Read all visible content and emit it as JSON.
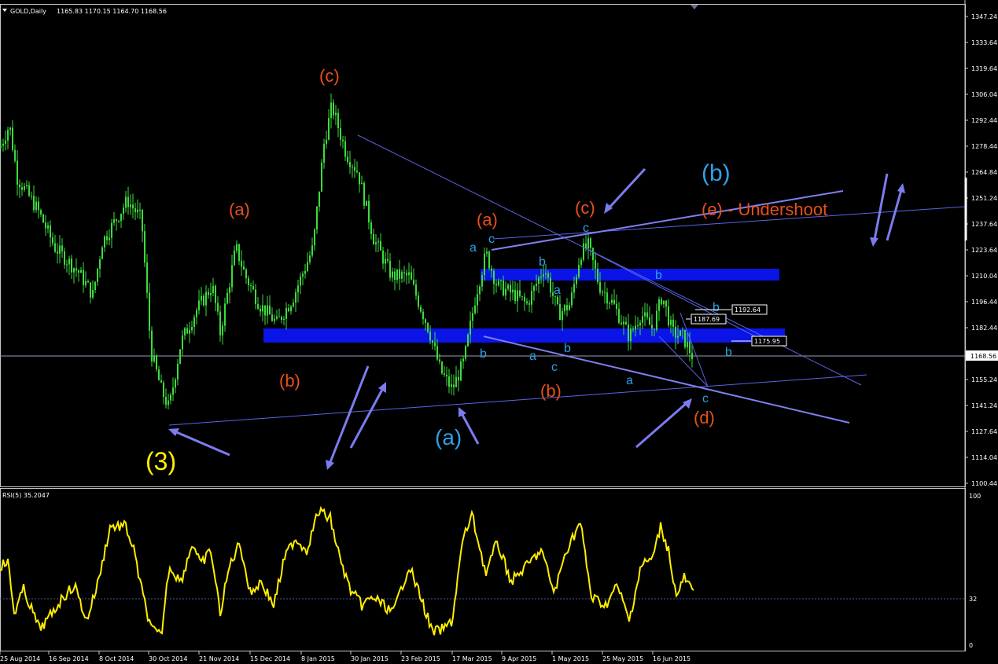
{
  "header": {
    "symbol": "GOLD,Daily",
    "ohlc": "1165.83 1170.15 1164.70 1168.56"
  },
  "indicator": {
    "label": "RSI(5) 35.2047",
    "levels": [
      "100",
      "32",
      "0"
    ]
  },
  "colors": {
    "background": "#000000",
    "candle": "#3cdc3c",
    "rsi": "#ffee00",
    "trendline": "#5a64e6",
    "arrow": "#7c7cf0",
    "zone": "#0a14e6",
    "wave_red": "#e8501c",
    "wave_blue": "#2f9fe8",
    "wave_yellow": "#ffee00",
    "grid": "#c8c8c8"
  },
  "price_axis": {
    "ticks": [
      "1347.24",
      "1333.64",
      "1319.64",
      "1306.04",
      "1292.44",
      "1278.44",
      "1264.84",
      "1251.24",
      "1237.64",
      "1223.64",
      "1210.04",
      "1196.44",
      "1182.44",
      "1168.56",
      "1155.24",
      "1141.24",
      "1127.64",
      "1114.04",
      "1100.44"
    ],
    "current_price": "1168.56"
  },
  "date_axis": {
    "labels": [
      "25 Aug 2014",
      "16 Sep 2014",
      "8 Oct 2014",
      "30 Oct 2014",
      "21 Nov 2014",
      "15 Dec 2014",
      "8 Jan 2015",
      "30 Jan 2015",
      "23 Feb 2015",
      "17 Mar 2015",
      "9 Apr 2015",
      "1 May 2015",
      "25 May 2015",
      "16 Jun 2015"
    ]
  },
  "price_boxes": [
    "1192.64",
    "1187.69",
    "1175.95"
  ],
  "wave_labels": {
    "yellow": [
      "(3)"
    ],
    "red": [
      "(c)",
      "(a)",
      "(b)",
      "(a)",
      "(c)",
      "(b)",
      "(d)",
      "(e) - Undershoot"
    ],
    "light_blue_large": [
      "(b)",
      "(a)"
    ],
    "blue_small": [
      "a",
      "c",
      "b",
      "a",
      "b",
      "c",
      "a",
      "b",
      "c",
      "b",
      "a",
      "b",
      "c",
      "b"
    ]
  },
  "chart_data": {
    "type": "candlestick",
    "title": "GOLD,Daily",
    "ylim": [
      1100.44,
      1347.24
    ],
    "last_close": 1168.56,
    "series": [
      {
        "name": "GOLD,Daily",
        "x": [
          "25 Aug 2014",
          "16 Sep 2014",
          "8 Oct 2014",
          "30 Oct 2014",
          "21 Nov 2014",
          "15 Dec 2014",
          "8 Jan 2015",
          "30 Jan 2015",
          "23 Feb 2015",
          "17 Mar 2015",
          "9 Apr 2015",
          "1 May 2015",
          "25 May 2015",
          "16 Jun 2015"
        ],
        "values": [
          1280,
          1230,
          1220,
          1170,
          1195,
          1185,
          1295,
          1265,
          1205,
          1160,
          1200,
          1190,
          1190,
          1180
        ]
      },
      {
        "name": "RSI(5)",
        "x": [
          "25 Aug 2014",
          "16 Sep 2014",
          "8 Oct 2014",
          "30 Oct 2014",
          "21 Nov 2014",
          "15 Dec 2014",
          "8 Jan 2015",
          "30 Jan 2015",
          "23 Feb 2015",
          "17 Mar 2015",
          "9 Apr 2015",
          "1 May 2015",
          "25 May 2015",
          "16 Jun 2015"
        ],
        "values": [
          45,
          30,
          70,
          8,
          60,
          55,
          88,
          45,
          40,
          15,
          60,
          55,
          50,
          35.2
        ]
      }
    ]
  }
}
